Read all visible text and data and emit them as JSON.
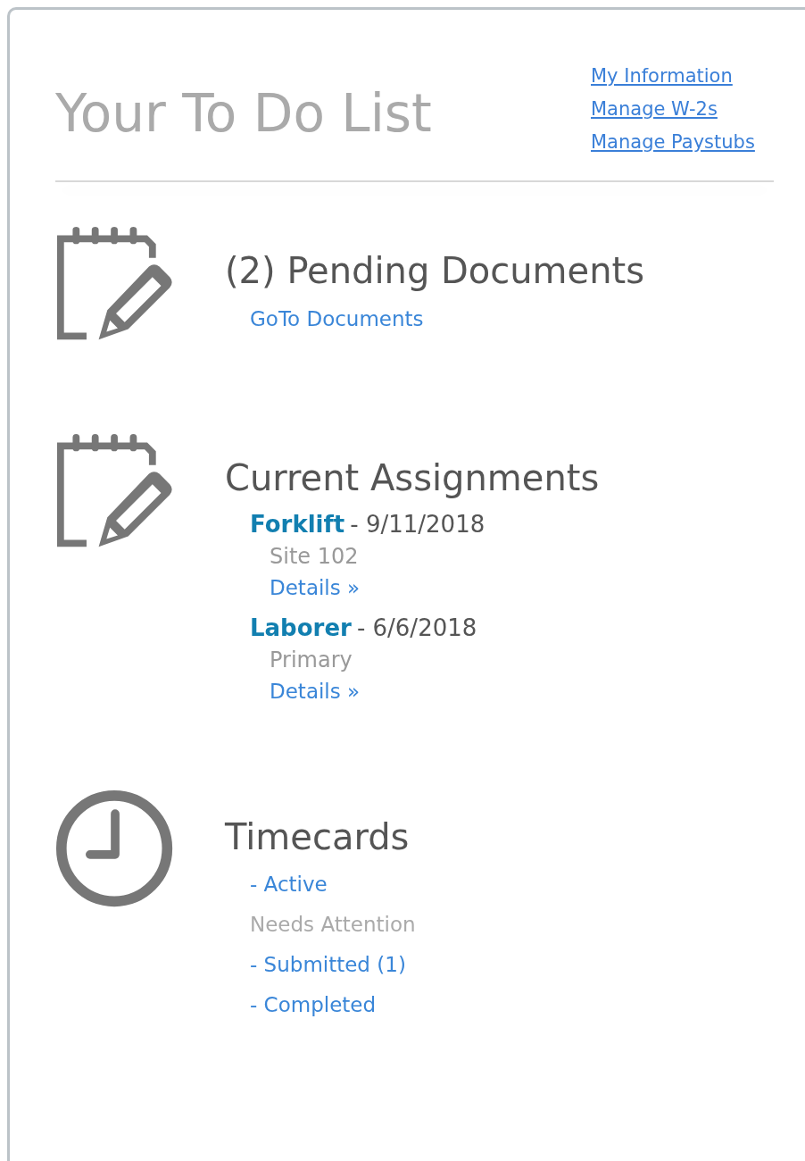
{
  "title": "Your To Do List",
  "links": [
    "My Information",
    "Manage W-2s",
    "Manage Paystubs"
  ],
  "sections": [
    {
      "kind": "documents",
      "heading": "(2) Pending Documents",
      "link": "GoTo Documents"
    },
    {
      "kind": "assignments",
      "heading": "Current Assignments",
      "assignments": [
        {
          "title": "Forklift",
          "date": "- 9/11/2018",
          "location": "Site 102",
          "link": "Details »"
        },
        {
          "title": "Laborer",
          "date": "- 6/6/2018",
          "location": "Primary",
          "link": "Details »"
        }
      ]
    },
    {
      "kind": "timecards",
      "heading": "Timecards",
      "items": [
        {
          "kind": "link",
          "label": "- Active"
        },
        {
          "kind": "label",
          "label": "Needs Attention"
        },
        {
          "kind": "link",
          "label": "- Submitted (1)"
        },
        {
          "kind": "link",
          "label": "- Completed"
        }
      ]
    }
  ]
}
